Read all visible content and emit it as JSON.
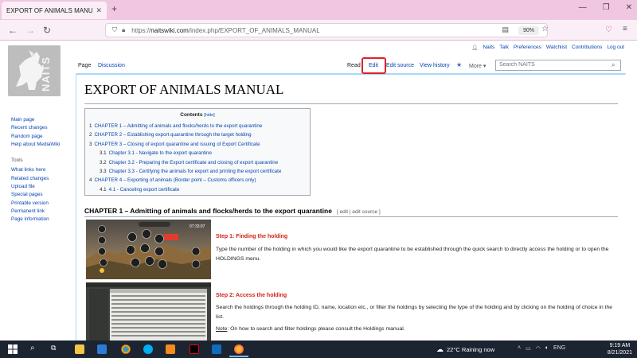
{
  "browser": {
    "tab_title": "EXPORT OF ANIMALS MANUAL - N",
    "url_prefix": "https://",
    "url_host": "naitswiki.com",
    "url_path": "/index.php/EXPORT_OF_ANIMALS_MANUAL",
    "zoom": "90%"
  },
  "personal": [
    "Naits",
    "Talk",
    "Preferences",
    "Watchlist",
    "Contributions",
    "Log out"
  ],
  "page_tabs": {
    "page": "Page",
    "discussion": "Discussion",
    "read": "Read",
    "edit": "Edit",
    "edit_source": "Edit source",
    "view_history": "View history",
    "more": "More"
  },
  "search_placeholder": "Search NAITS",
  "logo_text": "NAITS",
  "title": "EXPORT OF ANIMALS MANUAL",
  "toc": {
    "heading": "Contents",
    "hide": "[hide]",
    "items": [
      {
        "num": "1",
        "text": "CHAPTER 1 – Admitting of animals and flocks/herds to the export quarantine",
        "level": 1
      },
      {
        "num": "2",
        "text": "CHAPTER 2 – Establishing export quarantine through the target holding",
        "level": 1
      },
      {
        "num": "3",
        "text": "CHAPTER 3 – Closing of export quarantine and issuing of Export Certificate",
        "level": 1
      },
      {
        "num": "3.1",
        "text": "Chapter 3.1 - Navigate to the export quarantine",
        "level": 2
      },
      {
        "num": "3.2",
        "text": "Chapter 3.2 - Preparing the Export certificate and closing of export quarantine",
        "level": 2
      },
      {
        "num": "3.3",
        "text": "Chapter 3.3 - Certifying the animals for export and printing the export certificate",
        "level": 2
      },
      {
        "num": "4",
        "text": "CHAPTER 4 – Exporting of animals (Border point – Customs officers only)",
        "level": 1
      },
      {
        "num": "4.1",
        "text": "4.1 - Canceling export certificate",
        "level": 2
      }
    ]
  },
  "section": {
    "heading": "CHAPTER 1 – Admitting of animals and flocks/herds to the export quarantine",
    "edit_links": "[ edit | edit source ]"
  },
  "steps": [
    {
      "title": "Step 1: Finding the holding",
      "text": "Type the number of the holding in which you would like the export quarantine to be established through the quick search to directly access the holding or to open the HOLDINGS menu."
    },
    {
      "title": "Step 2: Access the holding",
      "text": "Search the holdings through the holding ID, name, location etc., or filter the holdings by selecting the type of the holding and by clicking on the holding of choice in the list.",
      "note_label": "Note",
      "note_text": ": On how to search and filter holdings please consult the Holdings manual."
    }
  ],
  "sidebar": {
    "nav": [
      "Main page",
      "Recent changes",
      "Random page",
      "Help about MediaWiki"
    ],
    "tools_heading": "Tools",
    "tools": [
      "What links here",
      "Related changes",
      "Upload file",
      "Special pages",
      "Printable version",
      "Permanent link",
      "Page information"
    ]
  },
  "taskbar": {
    "weather": "22°C  Raining now",
    "lang": "ENG",
    "time": "9:19 AM",
    "date": "8/21/2021"
  },
  "screenshot_time": "07:33:07"
}
